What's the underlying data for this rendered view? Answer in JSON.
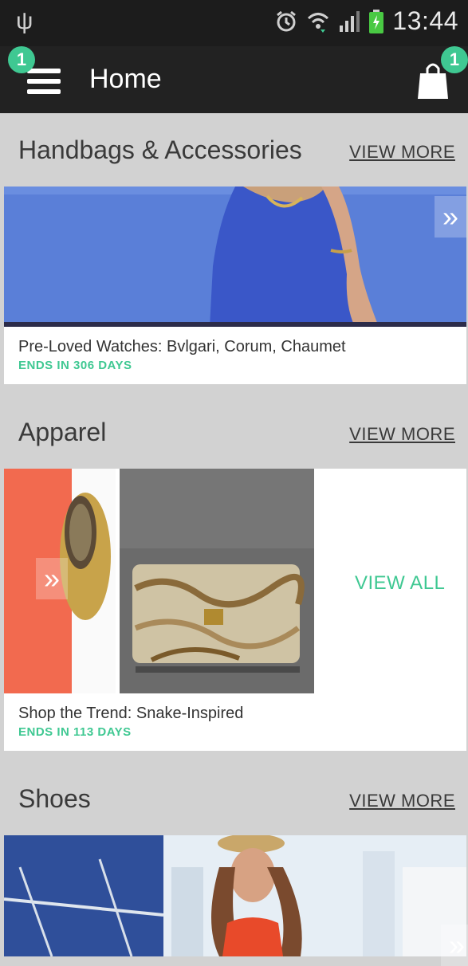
{
  "status_bar": {
    "usb_icon": "usb-icon",
    "alarm_icon": "alarm-icon",
    "wifi_icon": "wifi-icon",
    "signal_icon": "signal-icon",
    "battery_icon": "battery-icon",
    "time": "13:44"
  },
  "app_bar": {
    "title": "Home",
    "menu_badge": "1",
    "cart_badge": "1",
    "accent": "#3fc892"
  },
  "sections": [
    {
      "title": "Handbags & Accessories",
      "view_more": "VIEW MORE",
      "caption": "Pre-Loved Watches: Bvlgari, Corum, Chaumet",
      "ends": "ENDS IN 306 DAYS"
    },
    {
      "title": "Apparel",
      "view_more": "VIEW MORE",
      "caption": "Shop the Trend: Snake-Inspired",
      "ends": "ENDS IN 113 DAYS",
      "view_all": "VIEW ALL"
    },
    {
      "title": "Shoes",
      "view_more": "VIEW MORE"
    }
  ]
}
